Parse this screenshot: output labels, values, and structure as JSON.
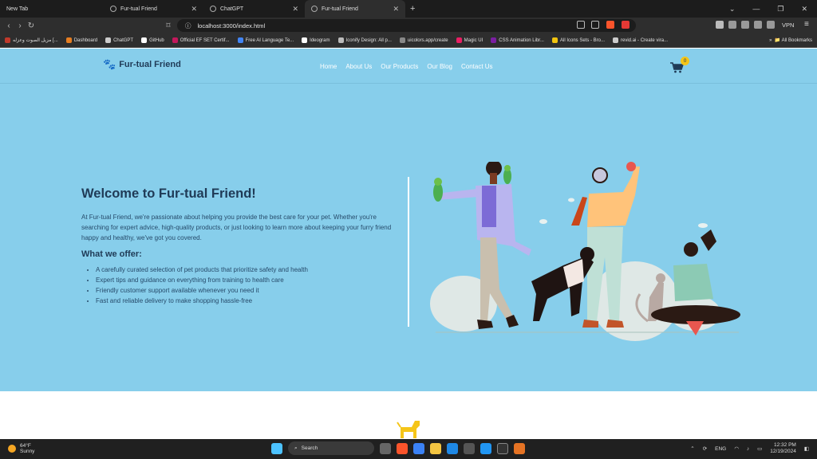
{
  "browser": {
    "tabs": [
      {
        "label": "New Tab"
      },
      {
        "label": "Fur-tual Friend"
      },
      {
        "label": "ChatGPT"
      },
      {
        "label": "Fur-tual Friend",
        "active": true
      }
    ],
    "url": "localhost:3000/index.html",
    "vpn_label": "VPN",
    "bookmarks": [
      {
        "label": "مزيل الصوت وعزله [...",
        "color": "#c0392b"
      },
      {
        "label": "Dashboard",
        "color": "#e67e22"
      },
      {
        "label": "ChatGPT",
        "color": "#cccccc"
      },
      {
        "label": "GitHub",
        "color": "#ffffff"
      },
      {
        "label": "Official EF SET Certif...",
        "color": "#c2185b"
      },
      {
        "label": "Free AI Language Te...",
        "color": "#4285f4"
      },
      {
        "label": "Ideogram",
        "color": "#ffffff"
      },
      {
        "label": "Iconify Design: All p...",
        "color": "#bbbbbb"
      },
      {
        "label": "uicolors.app/create",
        "color": "#888888"
      },
      {
        "label": "Magic UI",
        "color": "#e91e63"
      },
      {
        "label": "CSS Animation Libr...",
        "color": "#7b1fa2"
      },
      {
        "label": "All Icons Sets - Bro...",
        "color": "#f1c40f"
      },
      {
        "label": "revid.ai - Create vira...",
        "color": "#cccccc"
      }
    ],
    "all_bookmarks_label": "All Bookmarks"
  },
  "site": {
    "brand": "Fur-tual Friend",
    "nav": [
      "Home",
      "About Us",
      "Our Products",
      "Our Blog",
      "Contact Us"
    ],
    "cart_count": "0",
    "hero": {
      "title": "Welcome to Fur-tual Friend!",
      "intro": "At Fur-tual Friend, we're passionate about helping you provide the best care for your pet. Whether you're searching for expert advice, high-quality products, or just looking to learn more about keeping your furry friend happy and healthy, we've got you covered.",
      "offer_heading": "What we offer:",
      "offers": [
        "A carefully curated selection of pet products that prioritize safety and health",
        "Expert tips and guidance on everything from training to health care",
        "Friendly customer support available whenever you need it",
        "Fast and reliable delivery to make shopping hassle-free"
      ]
    },
    "colors": {
      "hero_bg": "#87ceeb",
      "heading": "#1f3a56",
      "accent": "#f5c518"
    }
  },
  "taskbar": {
    "temperature": "64°F",
    "condition": "Sunny",
    "search_placeholder": "Search",
    "language": "ENG",
    "time": "12:32 PM",
    "date": "12/19/2024"
  }
}
